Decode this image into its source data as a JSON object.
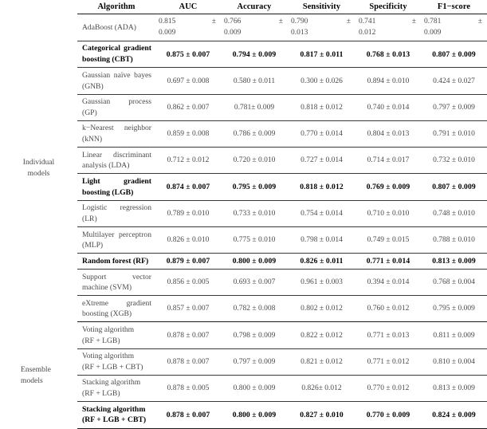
{
  "table": {
    "columns": [
      "",
      "Algorithm",
      "AUC",
      "Accuracy",
      "Sensitivity",
      "Specificity",
      "F1−score"
    ],
    "groups": [
      {
        "label_line1": "Individual",
        "label_line2": "models"
      },
      {
        "label_line1": "Ensemble",
        "label_line2": "models"
      }
    ],
    "rows": [
      {
        "group": "Individual models",
        "name_line1": "AdaBoost (ADA)",
        "name_line2": "",
        "split": true,
        "bold": false,
        "auc": "0.815",
        "auc_err": "0.009",
        "acc": "0.766",
        "acc_err": "0.009",
        "sen": "0.790",
        "sen_err": "0.013",
        "spe": "0.741",
        "spe_err": "0.012",
        "f1": "0.781",
        "f1_err": "0.009",
        "pm": "±"
      },
      {
        "group": "Individual models",
        "name_line1": "Categorical gradient",
        "name_line2": "boosting (CBT)",
        "split": false,
        "bold": true,
        "auc": "0.875 ± 0.007",
        "acc": "0.794 ± 0.009",
        "sen": "0.817 ± 0.011",
        "spe": "0.768 ± 0.013",
        "f1": "0.807 ± 0.009"
      },
      {
        "group": "Individual models",
        "name_line1": "Gaussian naïve bayes",
        "name_line2": "(GNB)",
        "split": false,
        "bold": false,
        "auc": "0.697 ± 0.008",
        "acc": "0.580 ± 0.011",
        "sen": "0.300 ± 0.026",
        "spe": "0.894 ± 0.010",
        "f1": "0.424 ± 0.027"
      },
      {
        "group": "Individual models",
        "name_line1": "Gaussian process",
        "name_line2": "(GP)",
        "split": false,
        "bold": false,
        "auc": "0.862 ± 0.007",
        "acc": "0.781± 0.009",
        "sen": "0.818 ± 0.012",
        "spe": "0.740 ± 0.014",
        "f1": "0.797 ± 0.009"
      },
      {
        "group": "Individual models",
        "name_line1": "k−Nearest neighbor",
        "name_line2": "(kNN)",
        "split": false,
        "bold": false,
        "auc": "0.859 ± 0.008",
        "acc": "0.786 ± 0.009",
        "sen": "0.770 ± 0.014",
        "spe": "0.804 ± 0.013",
        "f1": "0.791 ± 0.010"
      },
      {
        "group": "Individual models",
        "name_line1": "Linear discriminant",
        "name_line2": "analysis (LDA)",
        "split": false,
        "bold": false,
        "auc": "0.712 ± 0.012",
        "acc": "0.720 ± 0.010",
        "sen": "0.727 ± 0.014",
        "spe": "0.714 ± 0.017",
        "f1": "0.732 ± 0.010"
      },
      {
        "group": "Individual models",
        "name_line1": "Light gradient",
        "name_line2": "boosting (LGB)",
        "split": false,
        "bold": true,
        "auc": "0.874 ± 0.007",
        "acc": "0.795 ± 0.009",
        "sen": "0.818 ± 0.012",
        "spe": "0.769 ± 0.009",
        "f1": "0.807 ± 0.009"
      },
      {
        "group": "Individual models",
        "name_line1": "Logistic regression",
        "name_line2": "(LR)",
        "split": false,
        "bold": false,
        "auc": "0.789 ± 0.010",
        "acc": "0.733 ± 0.010",
        "sen": "0.754 ± 0.014",
        "spe": "0.710 ± 0.010",
        "f1": "0.748 ± 0.010"
      },
      {
        "group": "Individual models",
        "name_line1": "Multilayer perceptron",
        "name_line2": "(MLP)",
        "split": false,
        "bold": false,
        "auc": "0.826 ± 0.010",
        "acc": "0.775 ± 0.010",
        "sen": "0.798 ± 0.014",
        "spe": "0.749 ± 0.015",
        "f1": "0.788 ± 0.010"
      },
      {
        "group": "Individual models",
        "name_line1": "Random forest (RF)",
        "name_line2": "",
        "split": false,
        "bold": true,
        "auc": "0.879 ± 0.007",
        "acc": "0.800 ± 0.009",
        "sen": "0.826 ± 0.011",
        "spe": "0.771 ± 0.014",
        "f1": "0.813 ± 0.009"
      },
      {
        "group": "Individual models",
        "name_line1": "Support vector",
        "name_line2": "machine (SVM)",
        "split": false,
        "bold": false,
        "auc": "0.856 ± 0.005",
        "acc": "0.693 ± 0.007",
        "sen": "0.961 ± 0.003",
        "spe": "0.394 ± 0.014",
        "f1": "0.768 ± 0.004"
      },
      {
        "group": "Individual models",
        "name_line1": "eXtreme gradient",
        "name_line2": "boosting (XGB)",
        "split": false,
        "bold": false,
        "auc": "0.857 ± 0.007",
        "acc": "0.782 ± 0.008",
        "sen": "0.802 ± 0.012",
        "spe": "0.760 ± 0.012",
        "f1": "0.795 ± 0.009"
      },
      {
        "group": "Ensemble models",
        "name_line1": "Voting algorithm",
        "name_line2": "(RF + LGB)",
        "split": false,
        "bold": false,
        "flush": true,
        "auc": "0.878 ± 0.007",
        "acc": "0.798 ± 0.009",
        "sen": "0.822 ± 0.012",
        "spe": "0.771 ± 0.013",
        "f1": "0.811 ± 0.009"
      },
      {
        "group": "Ensemble models",
        "name_line1": "Voting algorithm",
        "name_line2": "(RF + LGB + CBT)",
        "split": false,
        "bold": false,
        "flush": true,
        "auc": "0.878 ± 0.007",
        "acc": "0.797 ± 0.009",
        "sen": "0.821 ± 0.012",
        "spe": "0.771 ± 0.012",
        "f1": "0.810 ± 0.004"
      },
      {
        "group": "Ensemble models",
        "name_line1": "Stacking algorithm",
        "name_line2": "(RF + LGB)",
        "split": false,
        "bold": false,
        "flush": true,
        "auc": "0.878 ± 0.005",
        "acc": "0.800 ± 0.009",
        "sen": "0.826± 0.012",
        "spe": "0.770 ± 0.012",
        "f1": "0.813 ± 0.009"
      },
      {
        "group": "Ensemble models",
        "name_line1": "Stacking algorithm",
        "name_line2": "(RF + LGB + CBT)",
        "split": false,
        "bold": true,
        "flush": true,
        "auc": "0.878 ± 0.007",
        "acc": "0.800 ± 0.009",
        "sen": "0.827 ± 0.010",
        "spe": "0.770 ± 0.009",
        "f1": "0.824 ± 0.009"
      }
    ]
  }
}
